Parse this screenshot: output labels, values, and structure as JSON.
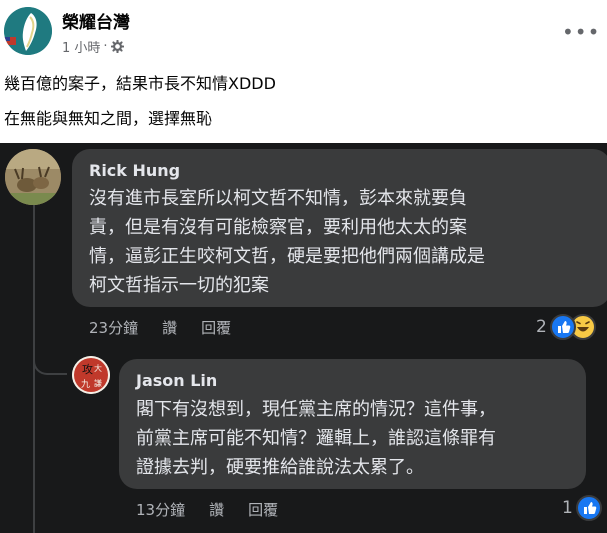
{
  "post": {
    "page_name": "榮耀台灣",
    "time": "1 小時",
    "separator": "·",
    "lines": [
      "幾百億的案子，結果市長不知情XDDD",
      "在無能與無知之間，選擇無恥"
    ]
  },
  "comments": [
    {
      "author": "Rick Hung",
      "lines": [
        "沒有進市長室所以柯文哲不知情，彭本來就要負",
        "責，但是有沒有可能檢察官，要利用他太太的案",
        "情，逼彭正生咬柯文哲，硬是要把他們兩個講成是",
        "柯文哲指示一切的犯案"
      ],
      "time": "23分鐘",
      "like_label": "讚",
      "reply_label": "回覆",
      "reaction_count": "2"
    },
    {
      "author": "Jason Lin",
      "avatar_text": [
        "攻",
        "大",
        "九",
        "謙"
      ],
      "lines": [
        "閣下有沒想到，現任黨主席的情況？這件事，",
        "前黨主席可能不知情？邏輯上，誰認這條罪有",
        "證據去判，硬要推給誰說法太累了。"
      ],
      "time": "13分鐘",
      "like_label": "讚",
      "reply_label": "回覆",
      "reaction_count": "1"
    }
  ],
  "colors": {
    "like_blue": "#1877f2",
    "haha_yellow": "#f7c945",
    "comment_bg": "#3a3b3c",
    "page_bg": "#18191a"
  }
}
